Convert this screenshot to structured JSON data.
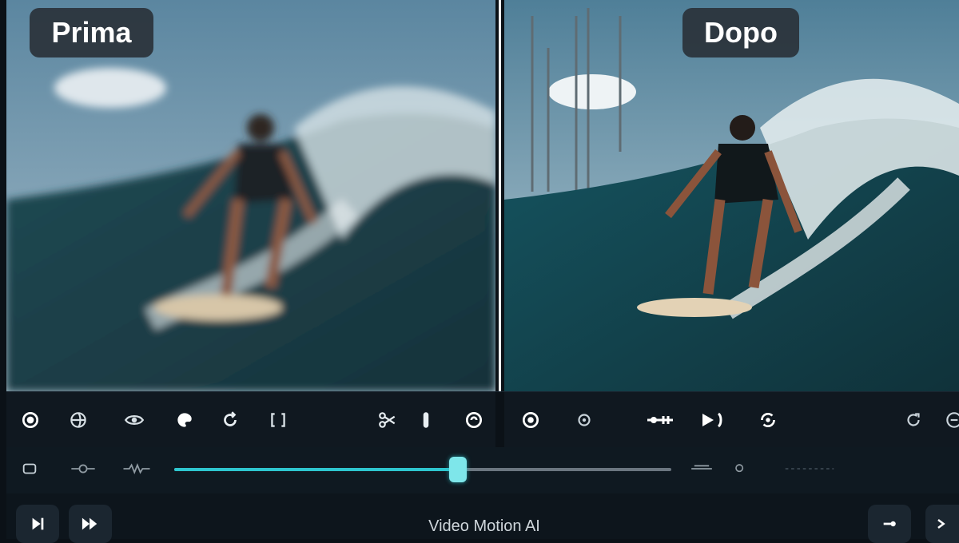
{
  "compare": {
    "before_label": "Prima",
    "after_label": "Dopo"
  },
  "toolbar": {
    "left_icons": [
      "record-icon",
      "globe-icon",
      "eye-icon",
      "palette-icon",
      "rotate-icon",
      "bracket-icon",
      "scissors-icon",
      "crop-icon",
      "refresh-icon"
    ],
    "right_icons": [
      "record-icon",
      "settings-icon",
      "split-icon",
      "play-frame-icon",
      "loop-icon",
      "redo-icon",
      "settings-icon"
    ]
  },
  "scrubber": {
    "progress": 0.57
  },
  "bottom": {
    "title": "Video Motion AI"
  },
  "colors": {
    "accent": "#2ec6cf",
    "panel": "#101820"
  }
}
